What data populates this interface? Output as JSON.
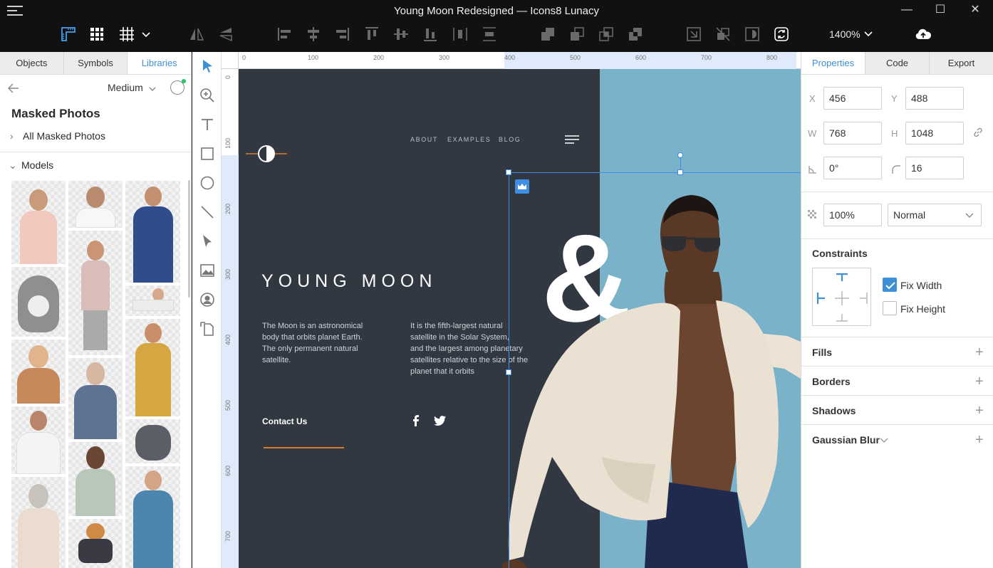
{
  "window": {
    "title": "Young Moon Redesigned — Icons8 Lunacy",
    "zoom_label": "1400%",
    "minimize_glyph": "—",
    "maximize_glyph": "☐",
    "close_glyph": "✕"
  },
  "left_panel": {
    "tabs": [
      "Objects",
      "Symbols",
      "Libraries"
    ],
    "active_tab": "Libraries",
    "size_select": "Medium",
    "library_title": "Masked Photos",
    "all_row": "All Masked Photos",
    "group": "Models"
  },
  "canvas": {
    "ruler_h": [
      "0",
      "100",
      "200",
      "300",
      "400",
      "500",
      "600",
      "700",
      "800"
    ],
    "ruler_v": [
      "0",
      "100",
      "200",
      "300",
      "400",
      "500",
      "600",
      "700"
    ],
    "nav": [
      "ABOUT",
      "EXAMPLES",
      "BLOG"
    ],
    "headline": "YOUNG MOON",
    "col1": [
      "The Moon is an astronomical",
      "body that orbits planet Earth.",
      "The only permanent natural",
      "satellite."
    ],
    "col2": [
      "It is the fifth-largest natural",
      "satellite in the Solar System,",
      "and the largest among planetary",
      "satellites relative to the size of the",
      "planet that it orbits"
    ],
    "contact": "Contact Us",
    "ampersand": "&",
    "colors": {
      "artboard": "#323842",
      "blue": "#79b2c9",
      "accent": "#d97b2a",
      "selection": "#3e8ee6"
    }
  },
  "right_panel": {
    "tabs": [
      "Properties",
      "Code",
      "Export"
    ],
    "active_tab": "Properties",
    "x_label": "X",
    "x": "456",
    "y_label": "Y",
    "y": "488",
    "w_label": "W",
    "w": "768",
    "h_label": "H",
    "h": "1048",
    "rotation": "0°",
    "radius": "16",
    "opacity": "100%",
    "blend": "Normal",
    "constraints_title": "Constraints",
    "fix_width": "Fix Width",
    "fix_height": "Fix Height",
    "sections": [
      "Fills",
      "Borders",
      "Shadows",
      "Gaussian Blur"
    ],
    "plus": "+"
  }
}
